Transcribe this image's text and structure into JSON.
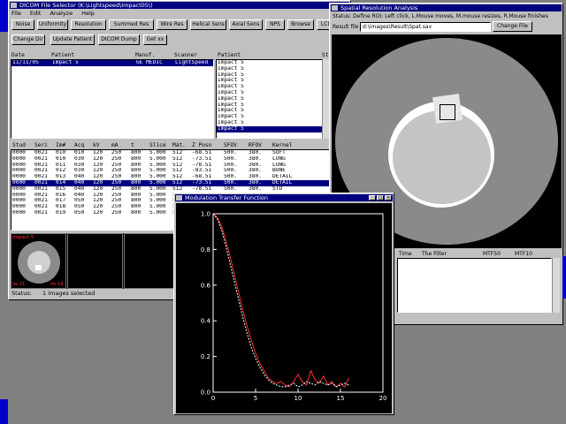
{
  "desktop_color": "#808080",
  "dicom_window": {
    "title": "DICOM File Selector (K:\\Lightspeed\\Impact05\\)",
    "menu": [
      "File",
      "Edit",
      "Analyze",
      "Help"
    ],
    "toolbar_row1": [
      "Noise",
      "Uniformity",
      "Resolution",
      "Summed Res",
      "Wire Res",
      "Helical Sens",
      "Axial Sens",
      "NPS",
      "Browse",
      "LCD"
    ],
    "toolbar_row2": [
      "Change Dir",
      "Update Patient",
      "DICOM Dump",
      "Get xx"
    ],
    "top_headers": [
      "Date",
      "Patient",
      "Manuf.",
      "Scanner",
      "Patient",
      "St"
    ],
    "top_row": {
      "date": "11/11/05",
      "patient": "Impact 5",
      "manuf": "GE MEDIC",
      "scanner": "LightSpeed"
    },
    "patient_list": [
      "Impact 5",
      "Impact 5",
      "Impact 5",
      "Impact 5",
      "Impact 5",
      "Impact 5",
      "Impact 5",
      "Impact 5",
      "Impact 5",
      "Impact 5",
      "Impact 5",
      "Impact 5"
    ],
    "patient_list_selected": 11,
    "series_headers": [
      "Stud",
      "Seri",
      "Im#",
      "Acq",
      "kV",
      "mA",
      "t",
      "Slice",
      "Mat.",
      "Z Posn",
      "SFOV",
      "RFOV",
      "Kernel"
    ],
    "series_rows": [
      [
        "0000",
        "0021",
        "010",
        "010",
        "120",
        "250",
        "800",
        "5.000",
        "512",
        "-68.51",
        "500.",
        "380.",
        "SOFT"
      ],
      [
        "0000",
        "0021",
        "010",
        "030",
        "120",
        "250",
        "800",
        "5.000",
        "512",
        "-73.51",
        "500.",
        "380.",
        "LUNG"
      ],
      [
        "0000",
        "0021",
        "011",
        "030",
        "120",
        "250",
        "800",
        "5.000",
        "512",
        "-78.51",
        "500.",
        "380.",
        "LUNG"
      ],
      [
        "0000",
        "0021",
        "012",
        "030",
        "120",
        "250",
        "800",
        "5.000",
        "512",
        "-83.51",
        "500.",
        "380.",
        "BONE"
      ],
      [
        "0000",
        "0021",
        "013",
        "040",
        "120",
        "250",
        "800",
        "5.000",
        "512",
        "-68.51",
        "500.",
        "380.",
        "DETAIL"
      ],
      [
        "0000",
        "0021",
        "014",
        "040",
        "120",
        "250",
        "800",
        "5.000",
        "512",
        "-73.51",
        "500.",
        "380.",
        "DETAIL"
      ],
      [
        "0000",
        "0021",
        "015",
        "040",
        "120",
        "250",
        "800",
        "5.000",
        "512",
        "-78.51",
        "500.",
        "380.",
        "STD"
      ],
      [
        "0000",
        "0021",
        "016",
        "040",
        "120",
        "250",
        "800",
        "5.000",
        "512",
        "-83.51",
        "500.",
        "380.",
        "STD"
      ],
      [
        "0000",
        "0021",
        "017",
        "050",
        "120",
        "250",
        "800",
        "5.000",
        "512",
        "-68.51",
        "500.",
        "380.",
        "STD"
      ],
      [
        "0000",
        "0021",
        "018",
        "050",
        "120",
        "250",
        "800",
        "5.000",
        "512",
        "-73.51",
        "500.",
        "380.",
        "BONE"
      ],
      [
        "0000",
        "0021",
        "019",
        "050",
        "120",
        "250",
        "800",
        "5.000",
        "512",
        "-78.51",
        "500.",
        "380.",
        "BONE"
      ]
    ],
    "series_selected": 5,
    "thumbnail_label": "Impact 5",
    "thumbnail_corner_a": "Se 21",
    "thumbnail_corner_b": "Im 14",
    "status_label": "Status:",
    "status_value": "1 images selected"
  },
  "spatial_window": {
    "title": "Spatial Resolution Analysis",
    "status_line": "Status: Define ROI: Left click, L.Mouse moves, M.mouse resizes, R.Mouse finishes",
    "result_label": "Result file",
    "result_value": "d:\\images\\Result\\Spat.sav",
    "change_file_button": "Change File",
    "table_headers": [
      "Time",
      "The Filter",
      "MTF50",
      "MTF10"
    ]
  },
  "mtf_window": {
    "title": "Modulation Transfer Function",
    "chart_data": {
      "type": "line",
      "title": "",
      "xlabel": "",
      "ylabel": "",
      "xlim": [
        0,
        20
      ],
      "ylim": [
        0,
        1.0
      ],
      "xticks": [
        0,
        5,
        10,
        15,
        20
      ],
      "yticks": [
        0.0,
        0.2,
        0.4,
        0.6,
        0.8,
        1.0
      ],
      "xtick_labels": [
        "0",
        "5",
        "10",
        "15",
        "20"
      ],
      "ytick_labels": [
        "0.0",
        "0.2",
        "0.4",
        "0.6",
        "0.8",
        "1.0"
      ],
      "series": [
        {
          "color": "#ff3030",
          "x": [
            0,
            0.5,
            1,
            1.5,
            2,
            2.5,
            3,
            3.5,
            4,
            4.5,
            5,
            5.5,
            6,
            6.5,
            7,
            7.5,
            8,
            8.5,
            9,
            9.5,
            10,
            10.5,
            11,
            11.5,
            12,
            12.5,
            13,
            13.5,
            14,
            14.5,
            15,
            15.5,
            16
          ],
          "y": [
            1.0,
            0.98,
            0.93,
            0.85,
            0.76,
            0.66,
            0.56,
            0.46,
            0.37,
            0.29,
            0.22,
            0.16,
            0.12,
            0.08,
            0.06,
            0.05,
            0.06,
            0.04,
            0.03,
            0.06,
            0.1,
            0.06,
            0.04,
            0.12,
            0.07,
            0.05,
            0.09,
            0.04,
            0.06,
            0.03,
            0.05,
            0.03,
            0.08
          ]
        },
        {
          "color": "#ffffff",
          "x": [
            0,
            0.5,
            1,
            1.5,
            2,
            2.5,
            3,
            3.5,
            4,
            4.5,
            5,
            5.5,
            6,
            6.5,
            7,
            7.5,
            8,
            8.5,
            9,
            9.5,
            10,
            10.5,
            11,
            11.5,
            12,
            12.5,
            13,
            13.5,
            14,
            14.5,
            15,
            15.5,
            16
          ],
          "y": [
            1.0,
            0.97,
            0.91,
            0.82,
            0.72,
            0.62,
            0.52,
            0.42,
            0.33,
            0.25,
            0.19,
            0.14,
            0.1,
            0.07,
            0.05,
            0.04,
            0.03,
            0.03,
            0.04,
            0.05,
            0.03,
            0.04,
            0.06,
            0.05,
            0.04,
            0.06,
            0.05,
            0.04,
            0.05,
            0.03,
            0.04,
            0.05,
            0.04
          ]
        }
      ]
    }
  }
}
